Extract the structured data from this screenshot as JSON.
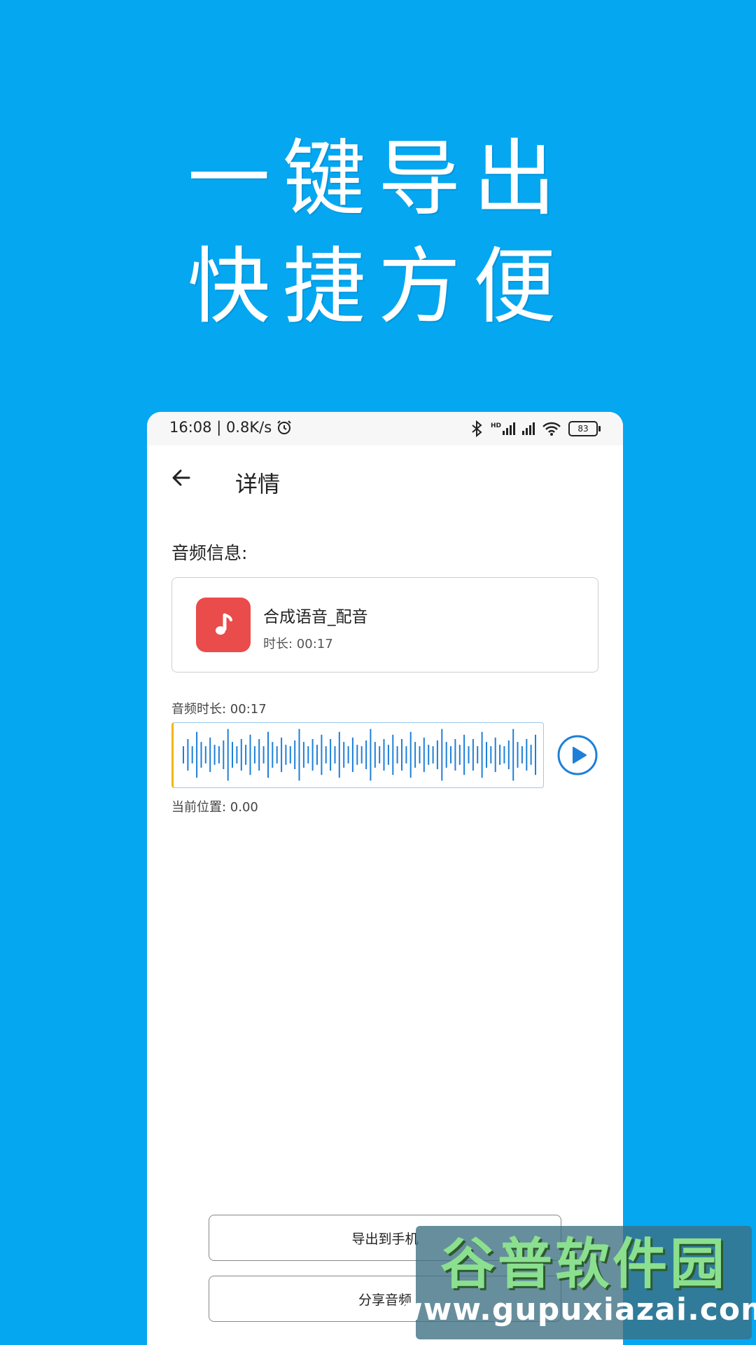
{
  "promo": {
    "line1": "一键导出",
    "line2": "快捷方便"
  },
  "status_bar": {
    "time_speed": "16:08 | 0.8K/s",
    "battery": "83",
    "network_badge": "HD",
    "icons": [
      "alarm-icon",
      "bluetooth-icon",
      "signal-icon",
      "signal-icon",
      "wifi-icon",
      "battery-icon"
    ]
  },
  "appbar": {
    "title": "详情"
  },
  "audio_info": {
    "section_label": "音频信息:",
    "name": "合成语音_配音",
    "duration": "时长: 00:17",
    "icon_color": "#EA4B4B"
  },
  "player": {
    "duration_label": "音频时长: 00:17",
    "position_label": "当前位置: 0.00",
    "progress": 0.0,
    "accent": "#1E7FD8",
    "cursor_color": "#F2B705"
  },
  "actions": {
    "export": "导出到手机",
    "share": "分享音频"
  },
  "watermark": {
    "top": "谷普软件园",
    "bottom": "www.gupuxiazai.com"
  }
}
